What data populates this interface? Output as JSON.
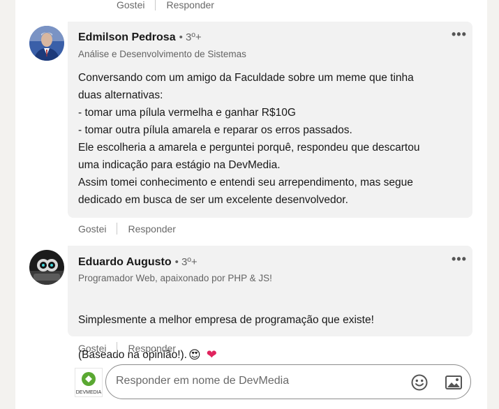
{
  "top_actions": {
    "like": "Gostei",
    "reply": "Responder"
  },
  "comments": [
    {
      "author": "Edmilson Pedrosa",
      "degree": "• 3º+",
      "headline": "Análise e Desenvolvimento de Sistemas",
      "text": "Conversando com um amigo da Faculdade sobre um meme que tinha\nduas alternativas:\n- tomar uma pílula vermelha e ganhar R$10G\n- tomar outra pílula amarela e reparar os erros passados.\nEle escolheria a amarela e perguntei porquê, respondeu que descartou\numa indicação para estágio na DevMedia.\nAssim tomei conhecimento e entendi seu arrependimento, mas segue\ndedicado em busca de ser um excelente desenvolvedor.",
      "like": "Gostei",
      "reply": "Responder"
    },
    {
      "author": "Eduardo Augusto",
      "degree": "• 3º+",
      "headline": "Programador Web, apaixonado por PHP & JS!",
      "text_line1": "Simplesmente a melhor empresa de programação que existe!",
      "text_line2": "(Baseado na opinião!).",
      "emoji1": "😍",
      "emoji2": "❤",
      "like": "Gostei",
      "reply": "Responder"
    }
  ],
  "reply_box": {
    "placeholder": "Responder em nome de DevMedia",
    "company_name": "DEVMEDIA"
  },
  "colors": {
    "bubble": "#f2f2f2",
    "heart": "#e0245e",
    "logo_green": "#5aa832"
  }
}
